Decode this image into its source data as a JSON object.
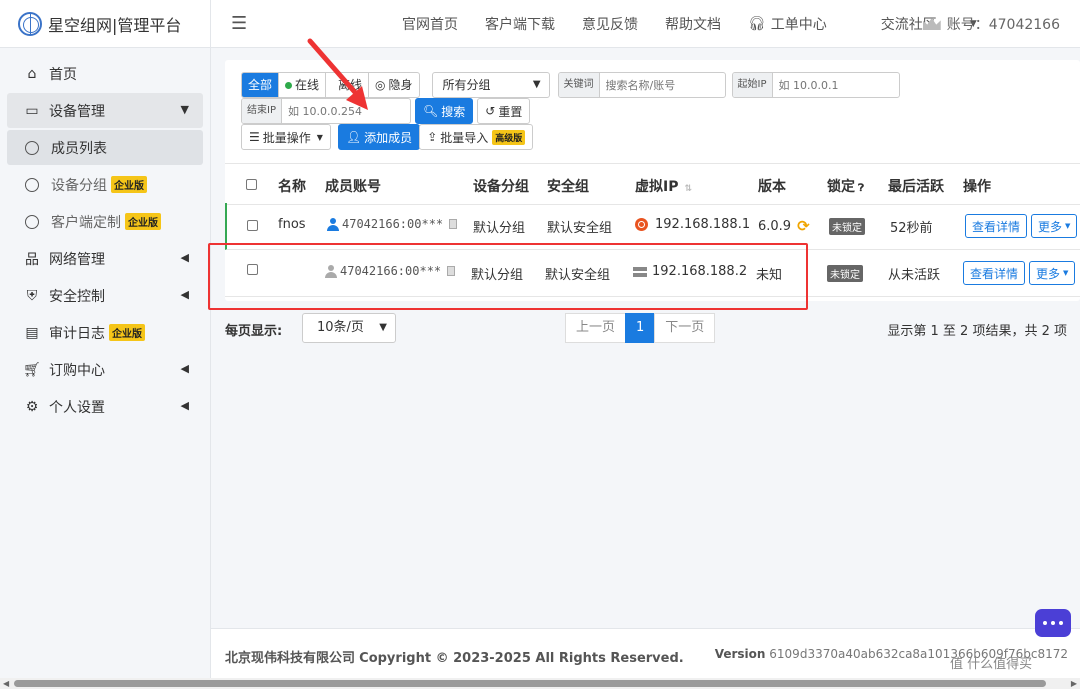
{
  "brand": {
    "title": "星空组网|管理平台"
  },
  "sidebar": {
    "items": [
      {
        "label": "首页"
      },
      {
        "label": "设备管理"
      },
      {
        "label": "成员列表"
      },
      {
        "label": "设备分组",
        "badge": "企业版"
      },
      {
        "label": "客户端定制",
        "badge": "企业版"
      },
      {
        "label": "网络管理"
      },
      {
        "label": "安全控制"
      },
      {
        "label": "审计日志",
        "badge": "企业版"
      },
      {
        "label": "订购中心"
      },
      {
        "label": "个人设置"
      }
    ]
  },
  "header": {
    "links": [
      "官网首页",
      "客户端下载",
      "意见反馈",
      "帮助文档",
      "工单中心",
      "交流社区"
    ],
    "account": "账号：47042166"
  },
  "filters": {
    "status_tabs": [
      "全部",
      "在线",
      "离线",
      "隐身"
    ],
    "group_select": "所有分组",
    "keyword_label": "关键词",
    "keyword_placeholder": "搜索名称/账号",
    "start_ip_label": "起始IP",
    "start_ip_placeholder": "如 10.0.0.1",
    "end_ip_label": "结束IP",
    "end_ip_placeholder": "如 10.0.0.254",
    "search_button": "搜索",
    "reset_button": "重置",
    "batch_ops": "批量操作",
    "add_member": "添加成员",
    "batch_import": "批量导入",
    "advanced_badge": "高级版"
  },
  "table": {
    "headers": [
      "名称",
      "成员账号",
      "设备分组",
      "安全组",
      "虚拟IP",
      "版本",
      "锁定",
      "最后活跃",
      "操作"
    ],
    "rows": [
      {
        "name": "fnos",
        "account": "47042166:00***",
        "group": "默认分组",
        "security": "默认安全组",
        "ip": "192.168.188.1",
        "version": "6.0.9",
        "lock": "未锁定",
        "last_active": "52秒前",
        "detail": "查看详情",
        "more": "更多"
      },
      {
        "name": "",
        "account": "47042166:00***",
        "group": "默认分组",
        "security": "默认安全组",
        "ip": "192.168.188.2",
        "version": "未知",
        "lock": "未锁定",
        "last_active": "从未活跃",
        "detail": "查看详情",
        "more": "更多"
      }
    ]
  },
  "pagination": {
    "per_page_label": "每页显示:",
    "per_page_value": "10条/页",
    "prev": "上一页",
    "current": "1",
    "next": "下一页",
    "summary": "显示第 1 至 2 项结果，共 2 项"
  },
  "footer": {
    "copyright_company": "北京现伟科技有限公司",
    "copyright_text": "Copyright © 2023-2025 All Rights Reserved.",
    "version_label": "Version",
    "version_hash": "6109d3370a40ab632ca8a101366b609f76bc8172"
  },
  "watermark": "值 什么值得买",
  "colors": {
    "primary": "#1a7be0",
    "online": "#2eaa4a",
    "badge_yellow": "#f5c518",
    "annotation_red": "#e33333"
  }
}
